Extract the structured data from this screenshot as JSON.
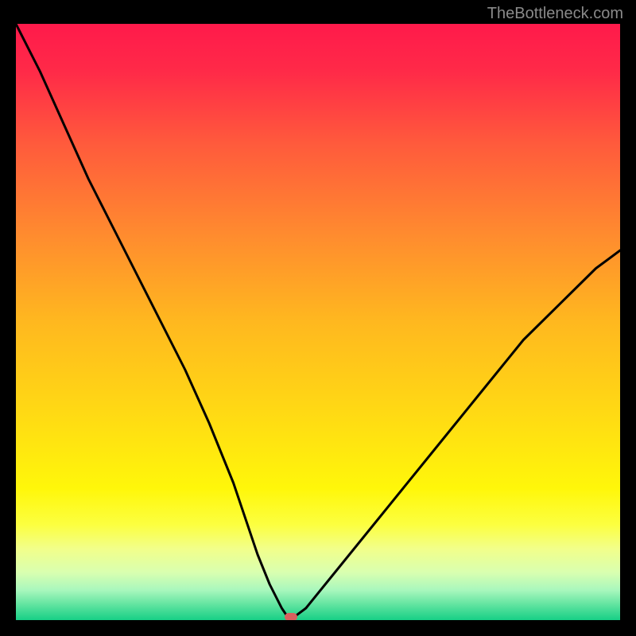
{
  "watermark": "TheBottleneck.com",
  "colors": {
    "marker": "#d8605e",
    "curve_stroke": "#000000",
    "gradient_stops": [
      {
        "offset": 0.0,
        "color": "#ff1a4b"
      },
      {
        "offset": 0.08,
        "color": "#ff2a48"
      },
      {
        "offset": 0.2,
        "color": "#ff5a3c"
      },
      {
        "offset": 0.35,
        "color": "#ff8a2f"
      },
      {
        "offset": 0.5,
        "color": "#ffb81f"
      },
      {
        "offset": 0.65,
        "color": "#ffd914"
      },
      {
        "offset": 0.78,
        "color": "#fff70a"
      },
      {
        "offset": 0.84,
        "color": "#fcff40"
      },
      {
        "offset": 0.88,
        "color": "#f2ff8a"
      },
      {
        "offset": 0.92,
        "color": "#d9ffb0"
      },
      {
        "offset": 0.95,
        "color": "#a8f7bd"
      },
      {
        "offset": 0.975,
        "color": "#5ee39f"
      },
      {
        "offset": 1.0,
        "color": "#17cf86"
      }
    ]
  },
  "chart_data": {
    "type": "line",
    "title": "",
    "xlabel": "",
    "ylabel": "",
    "xlim": [
      0,
      100
    ],
    "ylim": [
      0,
      100
    ],
    "grid": false,
    "legend": false,
    "x": [
      0,
      4,
      8,
      12,
      16,
      20,
      24,
      28,
      32,
      36,
      38,
      40,
      42,
      44,
      45,
      46,
      48,
      52,
      56,
      60,
      64,
      68,
      72,
      76,
      80,
      84,
      88,
      92,
      96,
      100
    ],
    "series": [
      {
        "name": "bottleneck-curve",
        "values": [
          100,
          92,
          83,
          74,
          66,
          58,
          50,
          42,
          33,
          23,
          17,
          11,
          6,
          2,
          0.5,
          0.5,
          2,
          7,
          12,
          17,
          22,
          27,
          32,
          37,
          42,
          47,
          51,
          55,
          59,
          62
        ]
      }
    ],
    "marker": {
      "x": 45.5,
      "y": 0.5,
      "color": "#d8605e"
    }
  }
}
